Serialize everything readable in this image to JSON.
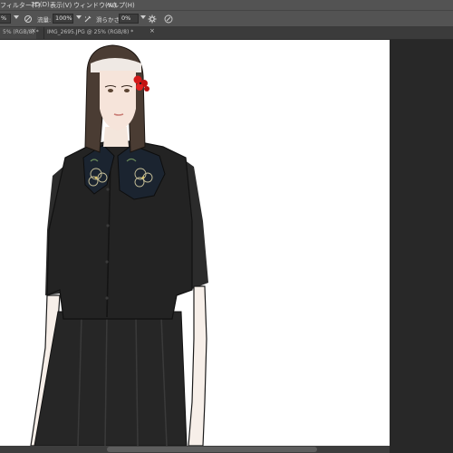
{
  "menubar": {
    "items": [
      "フィルター(T)",
      "3D(D)",
      "表示(V)",
      "ウィンドウ(W)",
      "ヘルプ(H)"
    ]
  },
  "options": {
    "opacity_partial": "%",
    "flow_label": "流量:",
    "flow_value": "100%",
    "smoothing_label": "滑らかさ:",
    "smoothing_value": "0%"
  },
  "tabs": [
    {
      "label": "5% (RGB/8) *",
      "close": "×"
    },
    {
      "label": "IMG_2695.JPG @ 25% (RGB/8) *",
      "close": "×"
    }
  ],
  "icons": {
    "brush_settings": "brush-icon",
    "airbrush": "airbrush-icon",
    "smoothing_settings": "gear-icon",
    "pressure": "pressure-icon"
  },
  "canvas": {
    "subject": "fashion illustration of a woman in a black shirt and skirt with a floral collar and a red flower hair clip"
  }
}
